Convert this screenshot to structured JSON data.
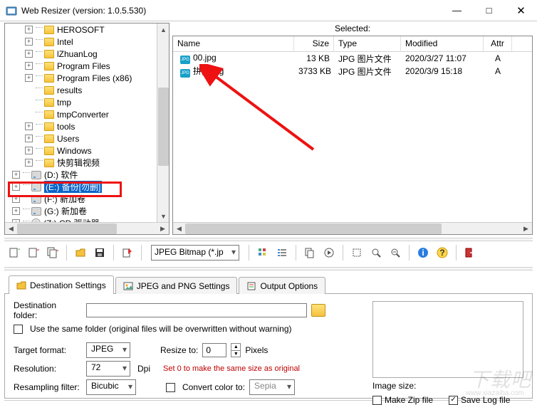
{
  "window": {
    "title": "Web Resizer (version: 1.0.5.530)",
    "min": "—",
    "max": "□",
    "close": "✕"
  },
  "tree": {
    "items": [
      {
        "indent": 1,
        "toggle": "plus",
        "icon": "folder",
        "label": "HEROSOFT"
      },
      {
        "indent": 1,
        "toggle": "plus",
        "icon": "folder",
        "label": "Intel"
      },
      {
        "indent": 1,
        "toggle": "plus",
        "icon": "folder",
        "label": "lZhuanLog"
      },
      {
        "indent": 1,
        "toggle": "plus",
        "icon": "folder",
        "label": "Program Files"
      },
      {
        "indent": 1,
        "toggle": "plus",
        "icon": "folder",
        "label": "Program Files (x86)"
      },
      {
        "indent": 1,
        "toggle": "none",
        "icon": "folder",
        "label": "results"
      },
      {
        "indent": 1,
        "toggle": "none",
        "icon": "folder",
        "label": "tmp"
      },
      {
        "indent": 1,
        "toggle": "none",
        "icon": "folder",
        "label": "tmpConverter"
      },
      {
        "indent": 1,
        "toggle": "plus",
        "icon": "folder",
        "label": "tools"
      },
      {
        "indent": 1,
        "toggle": "plus",
        "icon": "folder",
        "label": "Users"
      },
      {
        "indent": 1,
        "toggle": "plus",
        "icon": "folder",
        "label": "Windows"
      },
      {
        "indent": 1,
        "toggle": "plus",
        "icon": "folder",
        "label": "快剪辑视频"
      },
      {
        "indent": 0,
        "toggle": "plus",
        "icon": "drive",
        "label": "(D:) 软件"
      },
      {
        "indent": 0,
        "toggle": "plus",
        "icon": "drive",
        "label": "(E:) 备份[勿删]",
        "selected": true
      },
      {
        "indent": 0,
        "toggle": "plus",
        "icon": "drive",
        "label": "(F:) 新加卷"
      },
      {
        "indent": 0,
        "toggle": "plus",
        "icon": "drive",
        "label": "(G:) 新加卷"
      },
      {
        "indent": 0,
        "toggle": "plus",
        "icon": "cd",
        "label": "(Z:) CD 驱动器"
      }
    ]
  },
  "list": {
    "selected_label": "Selected:",
    "columns": {
      "name": "Name",
      "size": "Size",
      "type": "Type",
      "mod": "Modified",
      "attr": "Attr"
    },
    "rows": [
      {
        "name": "00.jpg",
        "size": "13 KB",
        "type": "JPG 图片文件",
        "mod": "2020/3/27 11:07",
        "attr": "A"
      },
      {
        "name": "拼接.jpg",
        "size": "3733 KB",
        "type": "JPG 图片文件",
        "mod": "2020/3/9 15:18",
        "attr": "A"
      }
    ]
  },
  "format_combo": "JPEG Bitmap (*.jp",
  "tabs": {
    "dest": "Destination Settings",
    "jpeg": "JPEG and PNG Settings",
    "output": "Output Options"
  },
  "settings": {
    "dest_folder_label": "Destination folder:",
    "dest_folder_value": "",
    "same_folder": "Use the same folder (original files will be overwritten without warning)",
    "target_format_label": "Target format:",
    "target_format_value": "JPEG",
    "resize_label": "Resize to:",
    "resize_value": "0",
    "resize_unit": "Pixels",
    "resize_hint": "Set 0 to make the same size as original",
    "resolution_label": "Resolution:",
    "resolution_value": "72",
    "resolution_unit": "Dpi",
    "resample_label": "Resampling filter:",
    "resample_value": "Bicubic",
    "convert_color_label": "Convert color to:",
    "convert_color_value": "Sepia"
  },
  "right": {
    "image_size_label": "Image size:",
    "make_zip": "Make Zip file",
    "save_log": "Save Log file"
  },
  "watermark": "下载吧",
  "watermark_sub": "www.xiazaiba.com"
}
